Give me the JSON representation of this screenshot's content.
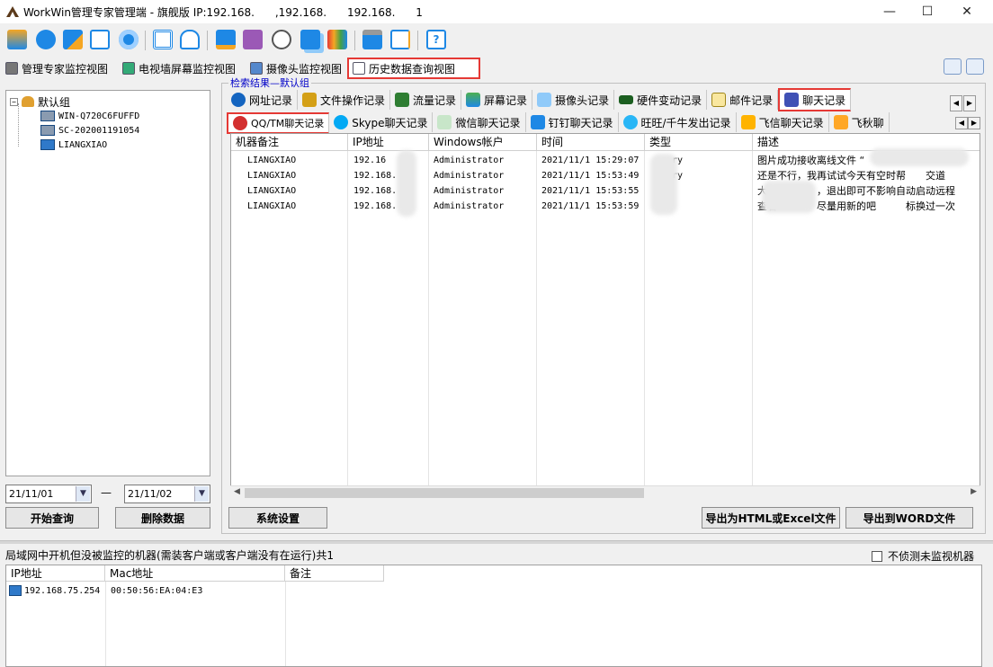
{
  "window": {
    "title": "WorkWin管理专家管理端 - 旗舰版 IP:192.168.      ,192.168.      192.168.      1",
    "minimize": "—",
    "maximize": "☐",
    "close": "✕"
  },
  "view_tabs": [
    {
      "label": "管理专家监控视图"
    },
    {
      "label": "电视墙屏幕监控视图"
    },
    {
      "label": "摄像头监控视图"
    },
    {
      "label": "历史数据查询视图",
      "active": true
    }
  ],
  "tree": {
    "root": "默认组",
    "expander": "−",
    "machines": [
      "WIN-Q720C6FUFFD",
      "SC-202001191054",
      "LIANGXIAO"
    ]
  },
  "date_range": {
    "start": "21/11/01",
    "separator": "—",
    "end": "21/11/02"
  },
  "left_buttons": {
    "query": "开始查询",
    "delete": "删除数据"
  },
  "results_caption": "检索结果—默认组",
  "record_tabs": [
    "网址记录",
    "文件操作记录",
    "流量记录",
    "屏幕记录",
    "摄像头记录",
    "硬件变动记录",
    "邮件记录",
    "聊天记录"
  ],
  "chat_tabs": [
    "QQ/TM聊天记录",
    "Skype聊天记录",
    "微信聊天记录",
    "钉钉聊天记录",
    "旺旺/千牛发出记录",
    "飞信聊天记录",
    "飞秋聊"
  ],
  "grid": {
    "columns": [
      "机器备注",
      "IP地址",
      "Windows帐户",
      "时间",
      "类型",
      "描述"
    ],
    "rows": [
      {
        "machine": "LIANGXIAO",
        "ip": "192.16",
        "account": "Administrator",
        "time": "2021/11/1 15:29:07",
        "type": "ry",
        "desc": "图片成功接收离线文件 “"
      },
      {
        "machine": "LIANGXIAO",
        "ip": "192.168.",
        "account": "Administrator",
        "time": "2021/11/1 15:53:49",
        "type": "ry",
        "desc": "还是不行，我再试试今天有空时帮　　交道"
      },
      {
        "machine": "LIANGXIAO",
        "ip": "192.168.",
        "account": "Administrator",
        "time": "2021/11/1 15:53:55",
        "type": "",
        "desc": "大　　　　　，退出即可不影响自动启动远程"
      },
      {
        "machine": "LIANGXIAO",
        "ip": "192.168.",
        "account": "Administrator",
        "time": "2021/11/1 15:53:59",
        "type": "",
        "desc": "查看　　　　尽量用新的吧　　　标换过一次"
      }
    ]
  },
  "right_buttons": {
    "settings": "系统设置",
    "export_html": "导出为HTML或Excel文件",
    "export_word": "导出到WORD文件"
  },
  "lan": {
    "title": "局域网中开机但没被监控的机器(需装客户端或客户端没有在运行)共1",
    "checkbox_label": "不侦测未监视机器",
    "columns": [
      "IP地址",
      "Mac地址",
      "备注"
    ],
    "rows": [
      {
        "ip": "192.168.75.254",
        "mac": "00:50:56:EA:04:E3",
        "note": ""
      }
    ]
  },
  "colors": {
    "highlight_red": "#e53935",
    "caption_blue": "#0000c8",
    "icon_blue": "#2f79c9"
  }
}
